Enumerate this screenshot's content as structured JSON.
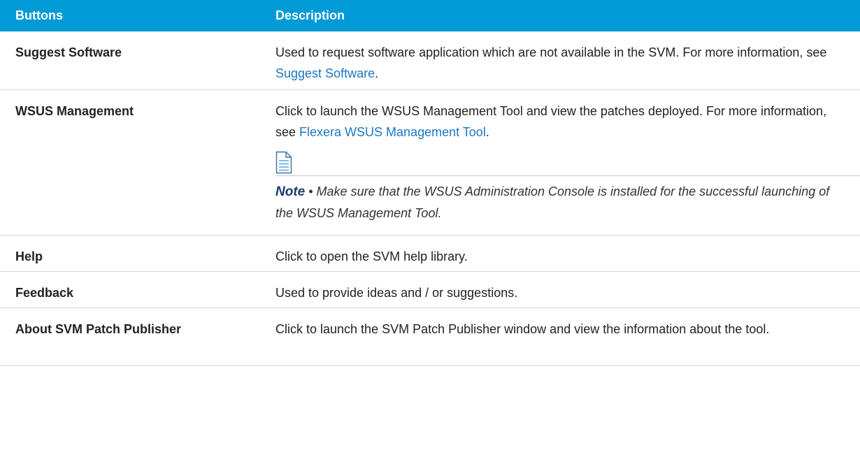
{
  "table": {
    "headers": {
      "buttons": "Buttons",
      "description": "Description"
    },
    "rows": [
      {
        "button": "Suggest Software",
        "desc_pre": "Used to request software application which are not available in the SVM. For more information, see ",
        "desc_link": "Suggest Software",
        "desc_post": "."
      },
      {
        "button": "WSUS Management",
        "desc_pre": "Click to launch the WSUS Management Tool and view the patches deployed. For more information, see ",
        "desc_link": "Flexera WSUS Management Tool",
        "desc_post": ".",
        "note": {
          "icon": "note-document-icon",
          "label": "Note",
          "separator": " • ",
          "text": "Make sure that the WSUS Administration Console is installed for the successful launching of the WSUS Management Tool."
        }
      },
      {
        "button": "Help",
        "desc": "Click to open the SVM help library."
      },
      {
        "button": "Feedback",
        "desc": "Used to provide ideas and / or suggestions."
      },
      {
        "button": "About SVM Patch Publisher",
        "desc": "Click to launch the SVM Patch Publisher window and view the information about the tool."
      }
    ]
  },
  "colors": {
    "header_bg": "#009ad7",
    "header_text": "#ffffff",
    "link": "#1a78c2",
    "note_label": "#1b3a6b",
    "row_border": "#d8d8d8"
  }
}
